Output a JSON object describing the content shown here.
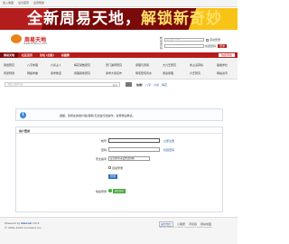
{
  "topbar": {
    "items": [
      "加入收藏",
      "设为首页",
      "设置帮助"
    ]
  },
  "banner": {
    "slogan": "全新周易天地，",
    "slogan_accent": "解锁新奇妙"
  },
  "logo": {
    "name": "周易天地",
    "url": "www.51zhiyi.com"
  },
  "search": {
    "row1_label": "帐号",
    "row1_placeholder": "用户名/Email",
    "row1_opt": "自动登录",
    "row1_button": "",
    "row2_label": "密码",
    "row2_opt": "找回密码",
    "row2_button": "登录"
  },
  "nav": {
    "items": [
      "周易天地",
      "社区首页",
      "论坛 (旧版)",
      "易图腾"
    ],
    "right": "快捷导航"
  },
  "subnav": {
    "row1": [
      "易经研究",
      "八字命理",
      "六爻占卜",
      "梅花易数研究",
      "奇门遁甲研究",
      "易理与周易",
      "大六壬研究",
      "命占演算综",
      "星相学社"
    ],
    "row2": [
      "周易预测",
      "网络学堂",
      "易学教室",
      "易理易象研究",
      "易学大家名作",
      "阴宅阳宅风水",
      "阅读易理",
      "六壬研究",
      "网站资讯"
    ]
  },
  "forum_search": {
    "placeholder": "请输入搜索内容",
    "select": "帖子",
    "hot_label": "热搜:",
    "hot_items": [
      "八字",
      "六爻",
      "梅花"
    ]
  },
  "notice": {
    "message": "抱歉，您所在的用户组(游客)无法进行此操作，请登录后重试。"
  },
  "login": {
    "title": "用户登录",
    "username_label": "帐号",
    "username_link": "立即注册",
    "password_label": "密码",
    "password_link": "找回密码",
    "question_label": "安全提问",
    "question_value": "安全提问(未设置请忽略)",
    "remember_label": "自动登录",
    "submit_label": "登录",
    "wechat_label": "快捷登录",
    "wechat_button": "微信登录"
  },
  "footer": {
    "powered": "Powered by",
    "brand": "Discuz!",
    "version": "X3.4",
    "copyright": "© 2001-2013 Comsenz Inc.",
    "badge": "站长统计",
    "links": [
      "小黑屋",
      "手机版",
      "网站地图"
    ],
    "sub": "GMT+8, 2024-10-10 08:59 , Processed in 0.0000 second(s)"
  },
  "colors": {
    "brand_red": "#b81b1b",
    "link_blue": "#2b5ea7",
    "banner_yellow": "#f7c317"
  }
}
